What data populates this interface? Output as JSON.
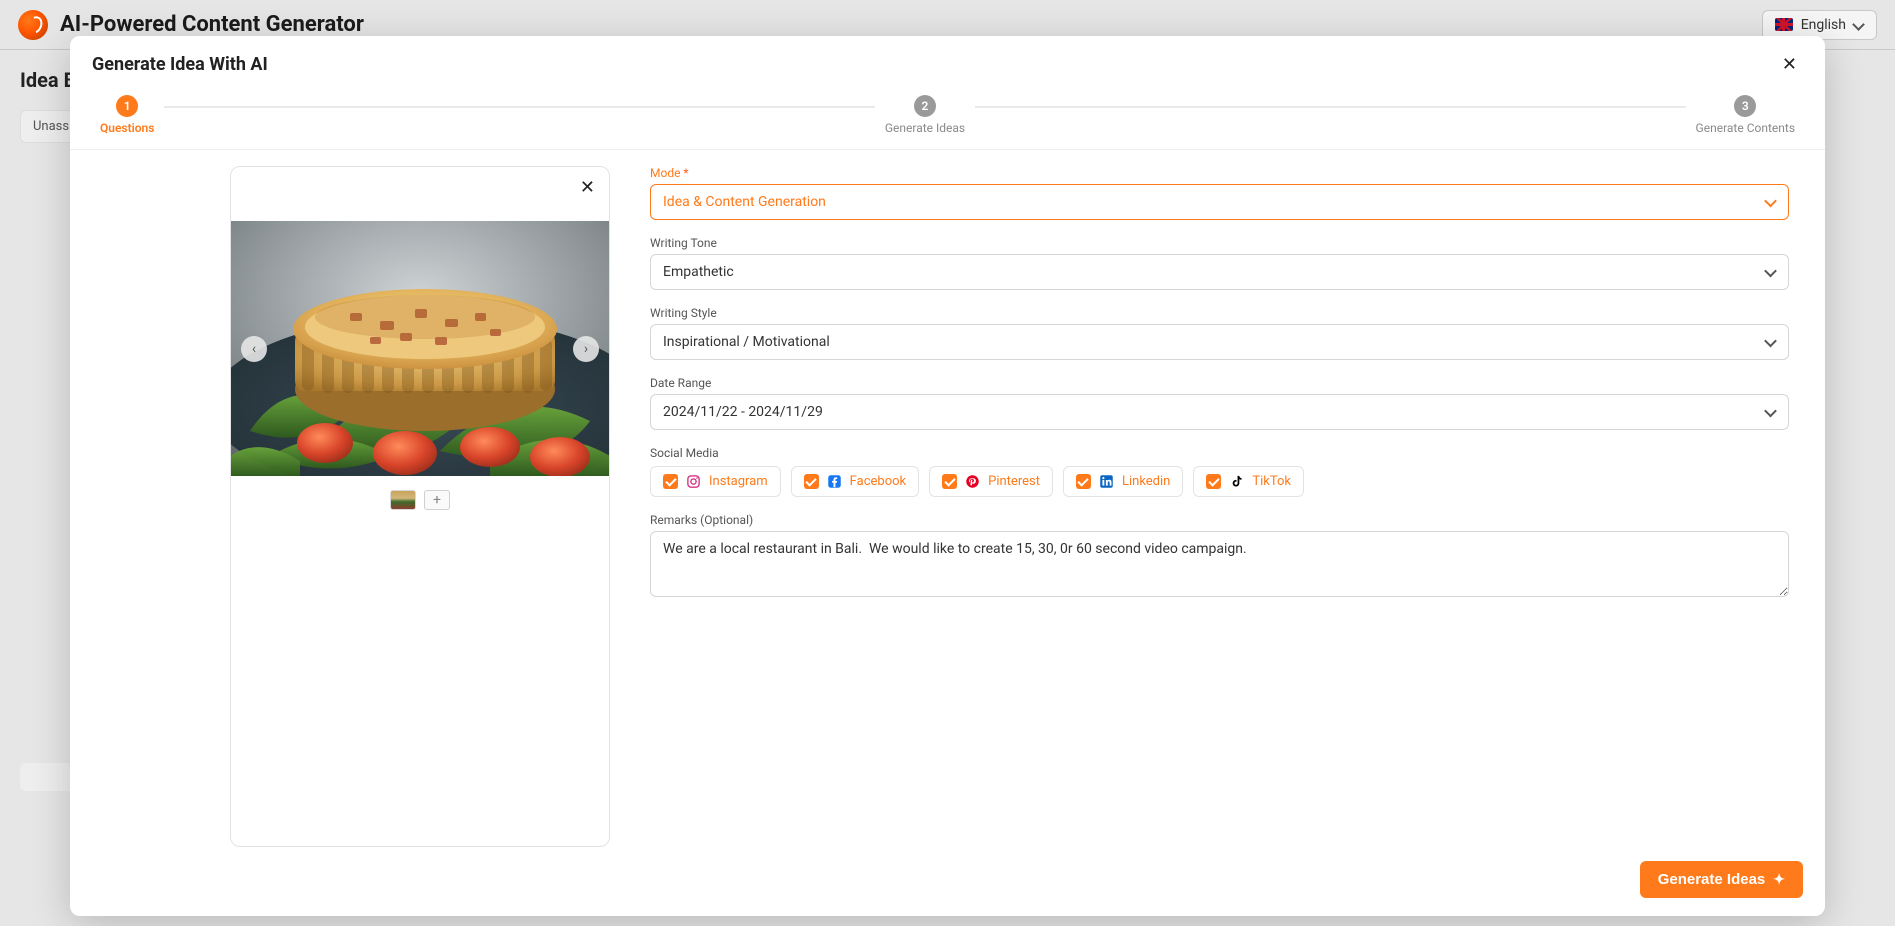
{
  "app": {
    "title": "AI-Powered Content Generator",
    "language_label": "English"
  },
  "bg": {
    "page_title": "Idea B",
    "chip_label": "Unassig"
  },
  "modal": {
    "title": "Generate Idea With AI",
    "steps": [
      {
        "num": "1",
        "label": "Questions"
      },
      {
        "num": "2",
        "label": "Generate Ideas"
      },
      {
        "num": "3",
        "label": "Generate Contents"
      }
    ],
    "submit_label": "Generate Ideas"
  },
  "form": {
    "mode": {
      "label": "Mode",
      "value": "Idea & Content Generation"
    },
    "tone": {
      "label": "Writing Tone",
      "value": "Empathetic"
    },
    "style": {
      "label": "Writing Style",
      "value": "Inspirational / Motivational"
    },
    "date_range": {
      "label": "Date Range",
      "value": "2024/11/22 - 2024/11/29"
    },
    "social_label": "Social Media",
    "social": [
      {
        "key": "instagram",
        "label": "Instagram",
        "color": "#d63384"
      },
      {
        "key": "facebook",
        "label": "Facebook",
        "color": "#1877F2"
      },
      {
        "key": "pinterest",
        "label": "Pinterest",
        "color": "#E60023"
      },
      {
        "key": "linkedin",
        "label": "Linkedin",
        "color": "#0A66C2"
      },
      {
        "key": "tiktok",
        "label": "TikTok",
        "color": "#000000"
      }
    ],
    "remarks_label": "Remarks (Optional)",
    "remarks_value": "We are a local restaurant in Bali.  We would like to create 15, 30, 0r 60 second video campaign."
  },
  "image": {
    "alt": "Food photo: quiche tart on salad greens with cherry tomatoes on a dark plate"
  },
  "colors": {
    "accent": "#ff7a1a"
  }
}
